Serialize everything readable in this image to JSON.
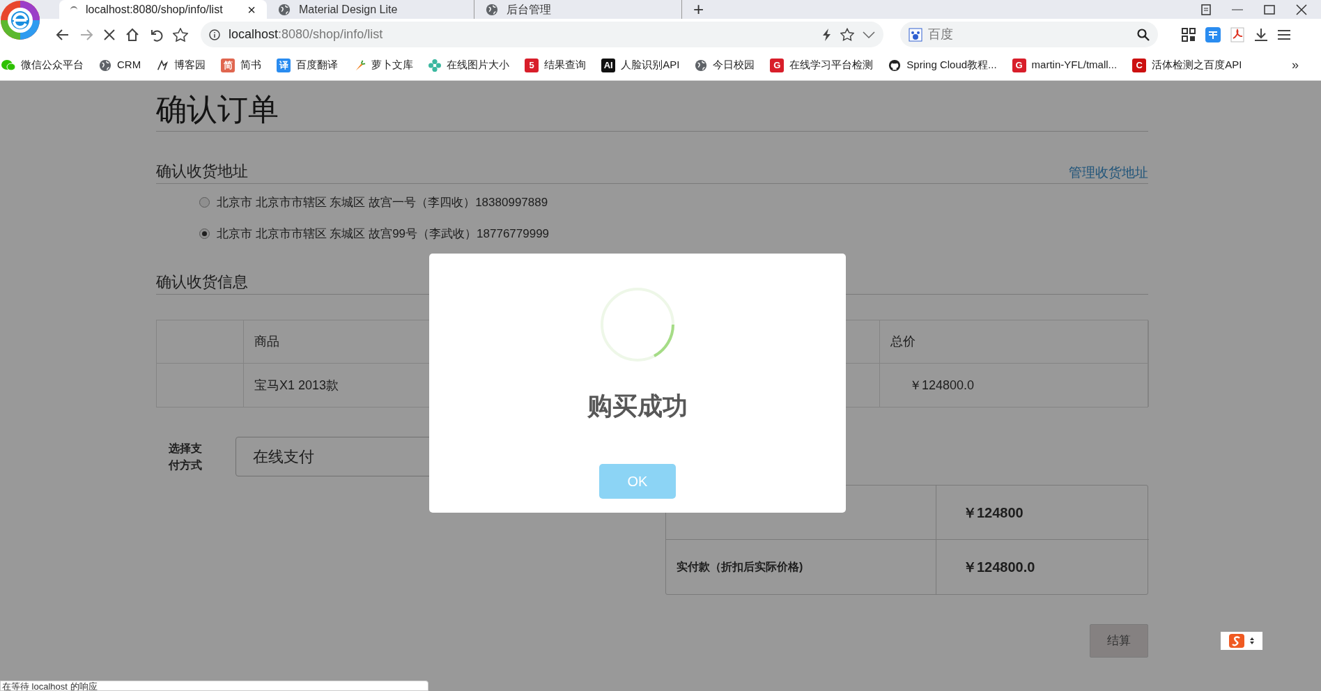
{
  "browser": {
    "tabs": [
      {
        "title": "localhost:8080/shop/info/list",
        "selected": true,
        "close": "×"
      },
      {
        "title": "Material Design Lite",
        "selected": false
      },
      {
        "title": "后台管理",
        "selected": false
      }
    ],
    "new_tab": "+",
    "address_host": "localhost",
    "address_path": ":8080/shop/info/list",
    "search_placeholder": "百度",
    "bookmarks": [
      {
        "label": "微信公众平台",
        "kind": "chat"
      },
      {
        "label": "CRM",
        "kind": "globe"
      },
      {
        "label": "博客园",
        "kind": "pen"
      },
      {
        "label": "简书",
        "kind": "badge",
        "badge": "简",
        "color": "#e0664f"
      },
      {
        "label": "百度翻译",
        "kind": "badge",
        "badge": "译",
        "color": "#2a8cf0"
      },
      {
        "label": "萝卜文库",
        "kind": "carrot"
      },
      {
        "label": "在线图片大小",
        "kind": "flower"
      },
      {
        "label": "结果查询",
        "kind": "badge",
        "badge": "5",
        "color": "#d81e2a"
      },
      {
        "label": "人脸识别API",
        "kind": "badge",
        "badge": "AI",
        "color": "#111111"
      },
      {
        "label": "今日校园",
        "kind": "globe"
      },
      {
        "label": "在线学习平台检测",
        "kind": "badge",
        "badge": "G",
        "color": "#d81e2a"
      },
      {
        "label": "Spring Cloud教程...",
        "kind": "github"
      },
      {
        "label": "martin-YFL/tmall...",
        "kind": "badge",
        "badge": "G",
        "color": "#d81e2a"
      },
      {
        "label": "活体检测之百度API",
        "kind": "badge",
        "badge": "C",
        "color": "#cc1010"
      }
    ],
    "more": "»"
  },
  "page": {
    "title": "确认订单",
    "address_section": {
      "heading": "确认收货地址",
      "manage_link": "管理收货地址",
      "addresses": [
        {
          "text": "北京市 北京市市辖区 东城区 故宫一号（李四收）18380997889",
          "selected": false
        },
        {
          "text": "北京市 北京市市辖区 东城区 故宫99号（李武收）18776779999",
          "selected": true
        }
      ]
    },
    "info_section": {
      "heading": "确认收货信息",
      "table": {
        "columns": [
          "商品",
          "总价"
        ],
        "rows": [
          [
            "宝马X1 2013款",
            "￥124800.0"
          ]
        ]
      }
    },
    "payment": {
      "label": "选择支付方式",
      "value": "在线支付"
    },
    "summary": [
      {
        "value": "￥124800"
      },
      {
        "label": "实付款（折扣后实际价格)",
        "value": "￥124800.0"
      }
    ],
    "checkout_button": "结算"
  },
  "dialog": {
    "title": "购买成功",
    "button": "OK"
  },
  "status_bar": "在等待 localhost 的响应"
}
